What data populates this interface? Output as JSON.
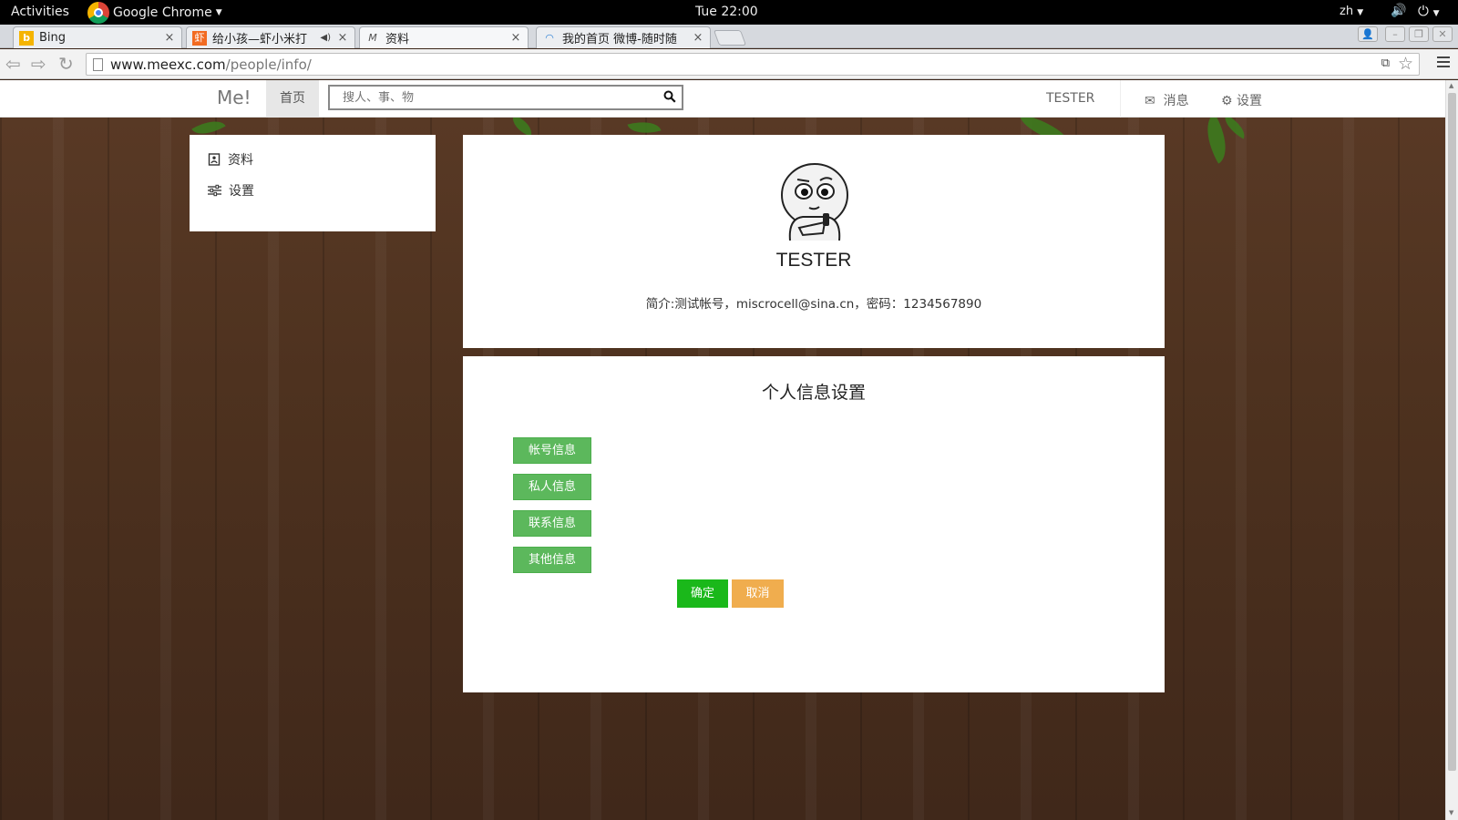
{
  "os_bar": {
    "activities": "Activities",
    "app_name": "Google Chrome",
    "clock": "Tue 22:00",
    "language": "zh"
  },
  "tabs": [
    {
      "title": "Bing",
      "favicon": "bing-icon",
      "close": "×"
    },
    {
      "title": "给小孩—虾小米打",
      "favicon": "xiami-icon",
      "close": "×"
    },
    {
      "title": "资料",
      "favicon": "meexc-icon",
      "close": "×"
    },
    {
      "title": "我的首页 微博-随时随",
      "favicon": "loading-icon",
      "close": "×"
    }
  ],
  "address_bar": {
    "domain": "www.meexc.com",
    "path": "/people/info/"
  },
  "navbar": {
    "brand": "Me!",
    "home": "首页",
    "search_placeholder": "搜人、事、物",
    "user": "TESTER",
    "messages": "消息",
    "settings": "设置"
  },
  "sidebar": {
    "items": [
      {
        "label": "资料",
        "icon": "profile-icon"
      },
      {
        "label": "设置",
        "icon": "sliders-icon"
      }
    ]
  },
  "profile": {
    "name": "TESTER",
    "bio": "简介:测试帐号，miscrocell@sina.cn，密码：1234567890"
  },
  "settings_panel": {
    "heading": "个人信息设置",
    "sections": [
      "帐号信息",
      "私人信息",
      "联系信息",
      "其他信息"
    ],
    "confirm": "确定",
    "cancel": "取消"
  },
  "colors": {
    "section_button": "#5cb85c",
    "confirm_button": "#1ab81a",
    "cancel_button": "#f0ad4e",
    "background_wood": "#4e321f"
  }
}
